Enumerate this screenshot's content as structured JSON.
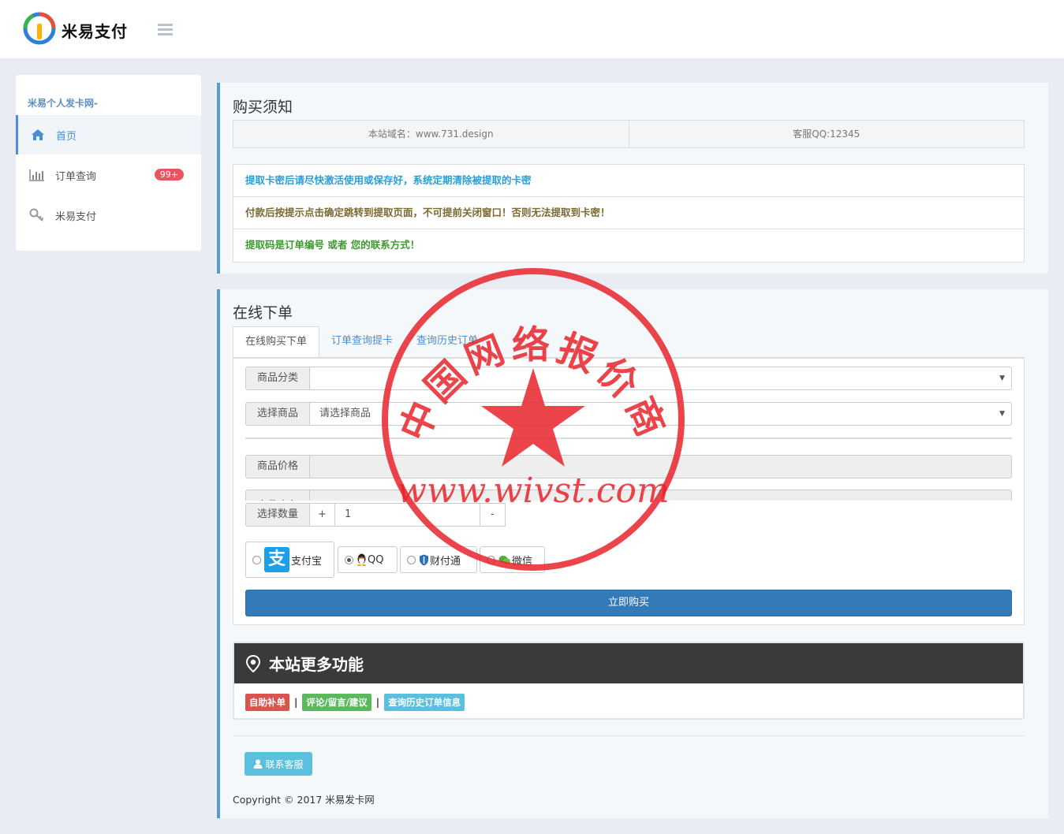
{
  "header": {
    "brand": "米易支付"
  },
  "sidebar": {
    "title": "米易个人发卡网-",
    "items": [
      {
        "label": "首页",
        "icon": "home-icon"
      },
      {
        "label": "订单查询",
        "icon": "bar-chart-icon",
        "badge": "99+"
      },
      {
        "label": "米易支付",
        "icon": "key-icon"
      }
    ]
  },
  "notice_panel": {
    "title": "购买须知",
    "domain": "本站域名：www.731.design",
    "service_qq": "客服QQ:12345",
    "notices": [
      {
        "text": "提取卡密后请尽快激活使用或保存好，系统定期清除被提取的卡密",
        "color": "#2a9fd6"
      },
      {
        "text": "付款后按提示点击确定跳转到提取页面，不可提前关闭窗口！否则无法提取到卡密！",
        "color": "#7a6a30"
      },
      {
        "text": "提取码是订单编号 或者 您的联系方式！",
        "color": "#3c9a2f"
      }
    ]
  },
  "order_panel": {
    "title": "在线下单",
    "tabs": [
      "在线购买下单",
      "订单查询提卡",
      "查询历史订单"
    ],
    "category": {
      "label": "商品分类",
      "value": ""
    },
    "product": {
      "label": "选择商品",
      "value": "请选择商品"
    },
    "price": {
      "label": "商品价格",
      "value": ""
    },
    "stock": {
      "label": "商品库存"
    },
    "quantity": {
      "label": "选择数量",
      "plus": "+",
      "value": "1",
      "minus": "-"
    },
    "payments": [
      {
        "label": "支付宝",
        "icon": "alipay-icon",
        "checked": false
      },
      {
        "label": "QQ",
        "icon": "qq-penguin-icon",
        "checked": true
      },
      {
        "label": "财付通",
        "icon": "tenpay-shield-icon",
        "checked": false
      },
      {
        "label": "微信",
        "icon": "wechat-icon",
        "checked": false
      }
    ],
    "buy_button": "立即购买"
  },
  "features": {
    "title": "本站更多功能",
    "tags": [
      {
        "label": "自助补单",
        "color": "#d9534f"
      },
      {
        "label": "评论/留言/建议",
        "color": "#5cb85c"
      },
      {
        "label": "查询历史订单信息",
        "color": "#5bc0de"
      }
    ],
    "separator": "|"
  },
  "footer": {
    "contact_button": "联系客服",
    "copyright": "Copyright © 2017 米易发卡网"
  },
  "watermark": {
    "text_top": "中国网络报价商",
    "url": "www.wivst.com",
    "color": "#e8242b"
  }
}
